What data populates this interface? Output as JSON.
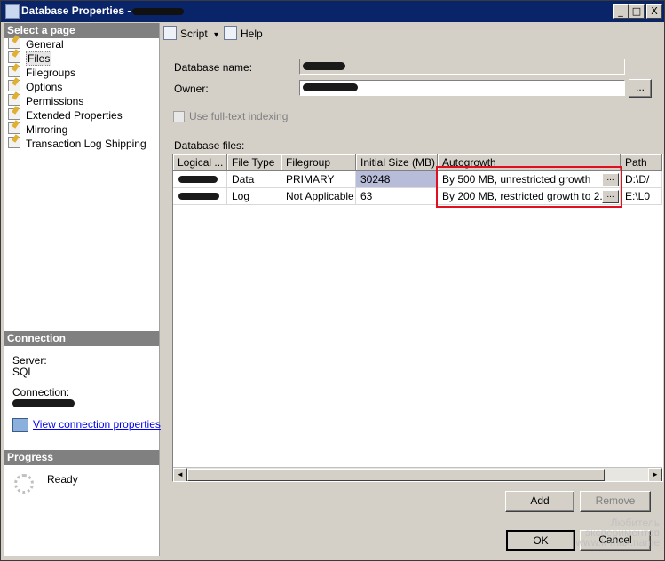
{
  "window": {
    "title": "Database Properties - "
  },
  "title_buttons": [
    "_",
    "□",
    "X"
  ],
  "left": {
    "select_page_header": "Select a page",
    "pages": [
      {
        "label": "General"
      },
      {
        "label": "Files",
        "selected": true
      },
      {
        "label": "Filegroups"
      },
      {
        "label": "Options"
      },
      {
        "label": "Permissions"
      },
      {
        "label": "Extended Properties"
      },
      {
        "label": "Mirroring"
      },
      {
        "label": "Transaction Log Shipping"
      }
    ],
    "connection_header": "Connection",
    "server_label": "Server:",
    "server_value": "SQL",
    "connection_label": "Connection:",
    "view_connection_link": "View connection properties",
    "progress_header": "Progress",
    "progress_status": "Ready"
  },
  "toolbar": {
    "script_label": "Script",
    "script_arrow": "▾",
    "help_label": "Help"
  },
  "form": {
    "db_name_label": "Database name:",
    "owner_label": "Owner:",
    "owner_browse": "...",
    "fulltext_label": "Use full-text indexing",
    "db_files_label": "Database files:"
  },
  "grid": {
    "columns": [
      "Logical ...",
      "File Type",
      "Filegroup",
      "Initial Size (MB)",
      "Autogrowth",
      "Path"
    ],
    "rows": [
      {
        "file_type": "Data",
        "filegroup": "PRIMARY",
        "initial_size": "30248",
        "autogrowth": "By 500 MB, unrestricted growth",
        "path": "D:\\D/"
      },
      {
        "file_type": "Log",
        "filegroup": "Not Applicable",
        "initial_size": "63",
        "autogrowth": "By 200 MB, restricted growth to 2...",
        "path": "E:\\L0"
      }
    ],
    "ellipsis": "...",
    "scroll_left": "◄",
    "scroll_right": "►"
  },
  "buttons": {
    "add": "Add",
    "remove": "Remove",
    "ok": "OK",
    "cancel": "Cancel"
  },
  "watermark": {
    "line1": "Любитель",
    "line2": "экспериментов",
    "line3": "www.k-max.name"
  },
  "colors": {
    "title_bar": "#0a246a",
    "highlight_box": "#e01020",
    "selected_cell": "#b7bcd9"
  }
}
